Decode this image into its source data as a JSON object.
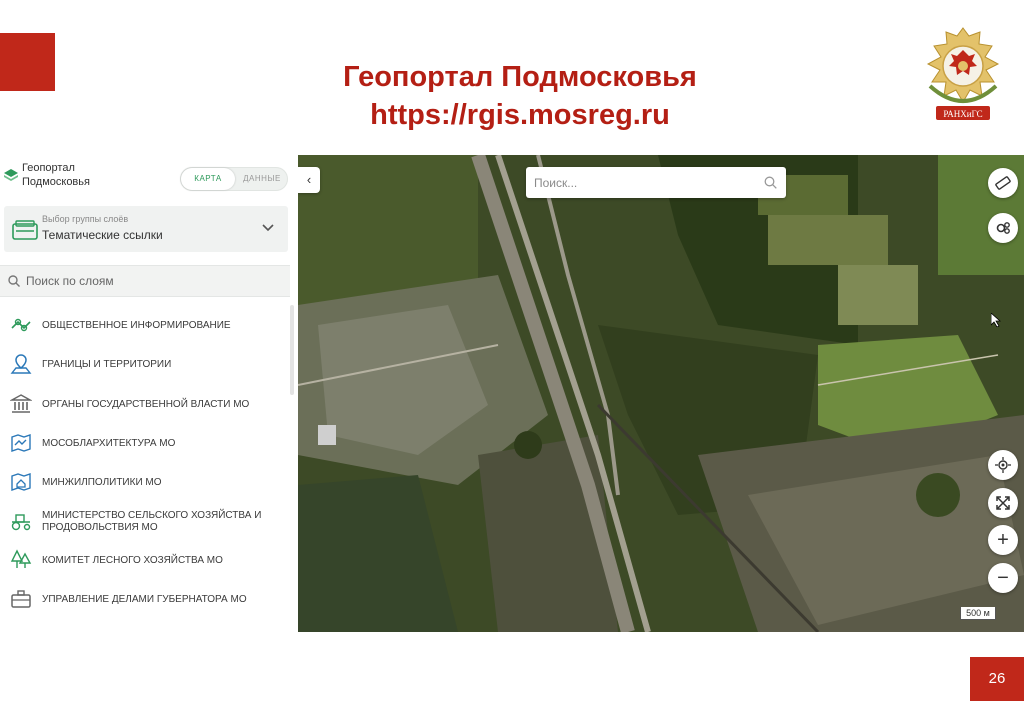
{
  "slide": {
    "title_line1": "Геопортал Подмосковья",
    "title_line2": "https://rgis.mosreg.ru",
    "page_number": "26",
    "emblem_text": "РАНХиГС",
    "accent_color": "#c0281a"
  },
  "portal": {
    "logo_line1": "Геопортал",
    "logo_line2": "Подмосковья",
    "toggle_map": "КАРТА",
    "toggle_data": "ДАННЫЕ",
    "active_toggle": "КАРТА",
    "brand_color": "#2e9a5b"
  },
  "group_select": {
    "label": "Выбор группы слоёв",
    "value": "Тематические ссылки"
  },
  "layer_search": {
    "placeholder": "Поиск по слоям"
  },
  "layers": [
    {
      "label": "ОБЩЕСТВЕННОЕ ИНФОРМИРОВАНИЕ",
      "icon": "map-pins-icon"
    },
    {
      "label": "ГРАНИЦЫ И ТЕРРИТОРИИ",
      "icon": "territory-pin-icon"
    },
    {
      "label": "ОРГАНЫ ГОСУДАРСТВЕННОЙ ВЛАСТИ МО",
      "icon": "government-building-icon"
    },
    {
      "label": "МОСОБЛАРХИТЕКТУРА МО",
      "icon": "architecture-map-icon"
    },
    {
      "label": "МИНЖИЛПОЛИТИКИ МО",
      "icon": "housing-map-icon"
    },
    {
      "label": "МИНИСТЕРСТВО СЕЛЬСКОГО ХОЗЯЙСТВА И ПРОДОВОЛЬСТВИЯ МО",
      "icon": "tractor-icon"
    },
    {
      "label": "КОМИТЕТ ЛЕСНОГО ХОЗЯЙСТВА МО",
      "icon": "trees-icon"
    },
    {
      "label": "УПРАВЛЕНИЕ ДЕЛАМИ ГУБЕРНАТОРА МО",
      "icon": "briefcase-icon"
    }
  ],
  "map": {
    "search_placeholder": "Поиск...",
    "scale_label": "500 м",
    "controls": [
      "ruler-icon",
      "layers-settings-icon",
      "locate-icon",
      "fullscreen-icon",
      "zoom-in-icon",
      "zoom-out-icon"
    ]
  }
}
